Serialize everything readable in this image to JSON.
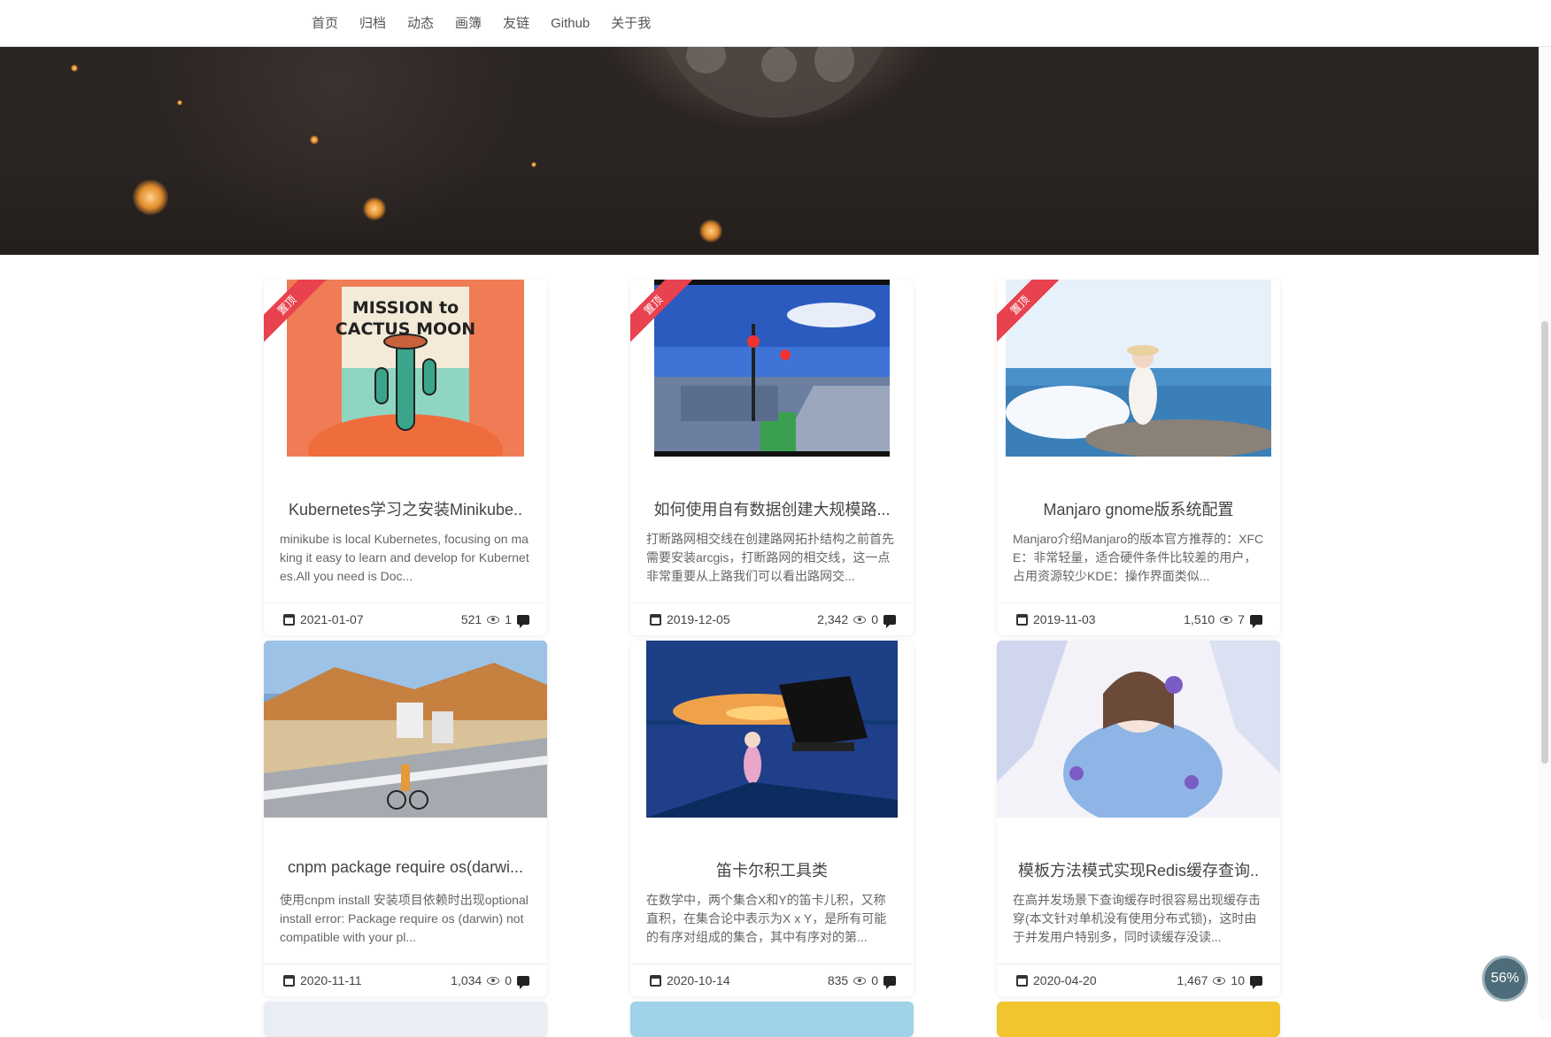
{
  "nav": {
    "items": [
      "首页",
      "归档",
      "动态",
      "画簿",
      "友链",
      "Github",
      "关于我"
    ]
  },
  "pinned_label": "置顶",
  "posts": [
    {
      "title": "Kubernetes学习之安装Minikube..",
      "excerpt": "minikube is local Kubernetes, focusing on making it easy to learn and develop for Kubernetes.All you need is Doc...",
      "date": "2021-01-07",
      "views": "521",
      "comments": "1",
      "pinned": true
    },
    {
      "title": "如何使用自有数据创建大规模路...",
      "excerpt": "打断路网相交线在创建路网拓扑结构之前首先需要安装arcgis，打断路网的相交线，这一点非常重要从上路我们可以看出路网交...",
      "date": "2019-12-05",
      "views": "2,342",
      "comments": "0",
      "pinned": true
    },
    {
      "title": "Manjaro gnome版系统配置",
      "excerpt": "Manjaro介绍Manjaro的版本官方推荐的：XFCE：非常轻量，适合硬件条件比较差的用户，占用资源较少KDE：操作界面类似...",
      "date": "2019-11-03",
      "views": "1,510",
      "comments": "7",
      "pinned": true
    },
    {
      "title": "cnpm package require os(darwi...",
      "excerpt": "使用cnpm install 安装项目依赖时出现optional install error: Package require os (darwin) not compatible with your pl...",
      "date": "2020-11-11",
      "views": "1,034",
      "comments": "0",
      "pinned": false
    },
    {
      "title": "笛卡尔积工具类",
      "excerpt": "在数学中，两个集合X和Y的笛卡儿积，又称直积，在集合论中表示为X x Y，是所有可能的有序对组成的集合，其中有序对的第...",
      "date": "2020-10-14",
      "views": "835",
      "comments": "0",
      "pinned": false
    },
    {
      "title": "模板方法模式实现Redis缓存查询..",
      "excerpt": "在高并发场景下查询缓存时很容易出现缓存击穿(本文针对单机没有使用分布式锁)，这时由于并发用户特别多，同时读缓存没读...",
      "date": "2020-04-20",
      "views": "1,467",
      "comments": "10",
      "pinned": false
    }
  ],
  "thumb_text": {
    "post0": "MISSION to CACTUS MOON"
  },
  "progress": "56%",
  "colors": {
    "ribbon": "#e8424f",
    "progress_bg": "#4e6c7a"
  }
}
